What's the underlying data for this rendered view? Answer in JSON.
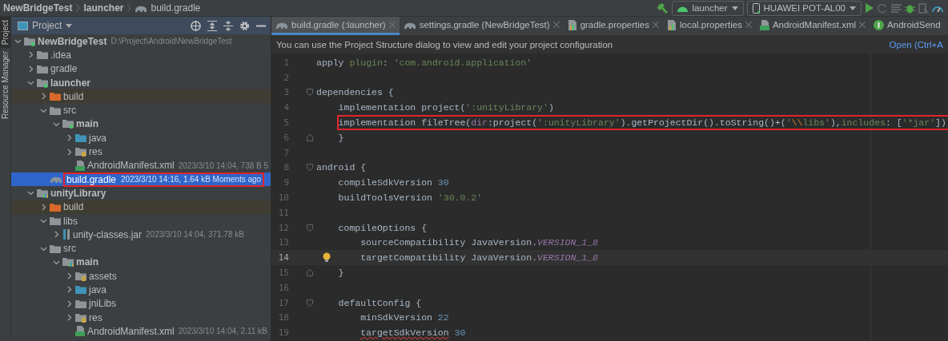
{
  "breadcrumb": [
    {
      "label": "NewBridgeTest",
      "kind": "module"
    },
    {
      "label": "launcher",
      "kind": "module"
    },
    {
      "label": "build.gradle",
      "kind": "file"
    }
  ],
  "toolbar": {
    "run_config": "launcher",
    "device": "HUAWEI POT-AL00"
  },
  "side_strip": [
    {
      "label": "Project",
      "selected": true
    },
    {
      "label": "Resource Manager",
      "selected": false
    }
  ],
  "project_panel": {
    "title": "Project",
    "tree": [
      {
        "name": "NewBridgeTest",
        "kind": "module",
        "bold": true,
        "meta": "D:\\Project\\Android\\NewBridgeTest",
        "expanded": true,
        "children": [
          {
            "name": ".idea",
            "kind": "folder",
            "expanded": false
          },
          {
            "name": "gradle",
            "kind": "folder",
            "expanded": false
          },
          {
            "name": "launcher",
            "kind": "module",
            "bold": true,
            "expanded": true,
            "children": [
              {
                "name": "build",
                "kind": "excluded",
                "excluded": true,
                "expanded": false
              },
              {
                "name": "src",
                "kind": "folder",
                "expanded": true,
                "children": [
                  {
                    "name": "main",
                    "kind": "module",
                    "bold": true,
                    "expanded": true,
                    "children": [
                      {
                        "name": "java",
                        "kind": "source",
                        "expanded": false
                      },
                      {
                        "name": "res",
                        "kind": "resource",
                        "expanded": false
                      },
                      {
                        "name": "AndroidManifest.xml",
                        "kind": "manifest",
                        "meta": "2023/3/10 14:04, 738 B 5"
                      }
                    ]
                  }
                ]
              },
              {
                "name": "build.gradle",
                "kind": "gradle",
                "meta": "2023/3/10 14:16, 1.64 kB Moments ago",
                "selected": true,
                "annotated": true
              }
            ]
          },
          {
            "name": "unityLibrary",
            "kind": "library",
            "bold": true,
            "expanded": true,
            "children": [
              {
                "name": "build",
                "kind": "excluded",
                "excluded": true,
                "expanded": false
              },
              {
                "name": "libs",
                "kind": "folder",
                "expanded": true,
                "children": [
                  {
                    "name": "unity-classes.jar",
                    "kind": "jar",
                    "meta": "2023/3/10 14:04, 371.78 kB",
                    "expanded": false
                  }
                ]
              },
              {
                "name": "src",
                "kind": "folder",
                "expanded": true,
                "children": [
                  {
                    "name": "main",
                    "kind": "library",
                    "bold": true,
                    "expanded": true,
                    "children": [
                      {
                        "name": "assets",
                        "kind": "resource",
                        "expanded": false
                      },
                      {
                        "name": "java",
                        "kind": "source",
                        "expanded": false
                      },
                      {
                        "name": "jniLibs",
                        "kind": "folder",
                        "expanded": false
                      },
                      {
                        "name": "res",
                        "kind": "resource",
                        "expanded": false
                      },
                      {
                        "name": "AndroidManifest.xml",
                        "kind": "manifest",
                        "meta": "2023/3/10 14:04, 2.11 kB"
                      }
                    ]
                  }
                ]
              }
            ]
          }
        ]
      }
    ]
  },
  "tabs": [
    {
      "label": "build.gradle (:launcher)",
      "kind": "gradle",
      "selected": true,
      "closable": true
    },
    {
      "label": "settings.gradle (NewBridgeTest)",
      "kind": "gradle",
      "selected": false,
      "closable": true
    },
    {
      "label": "gradle.properties",
      "kind": "properties",
      "selected": false,
      "closable": true
    },
    {
      "label": "local.properties",
      "kind": "properties",
      "selected": false,
      "closable": true
    },
    {
      "label": "AndroidManifest.xml",
      "kind": "manifest",
      "selected": false,
      "closable": true
    },
    {
      "label": "AndroidSend",
      "kind": "class",
      "selected": false,
      "closable": false
    }
  ],
  "notification": {
    "text": "You can use the Project Structure dialog to view and edit your project configuration",
    "link": "Open (Ctrl+A"
  },
  "code": [
    {
      "number": "1",
      "tokens": [
        {
          "kind": "plain",
          "text": "apply "
        },
        {
          "kind": "named",
          "text": "plugin"
        },
        {
          "kind": "plain",
          "text": ": "
        },
        {
          "kind": "string",
          "text": "'com.android.application'"
        }
      ]
    },
    {
      "number": "2"
    },
    {
      "number": "3",
      "fold_open": true,
      "tokens": [
        {
          "kind": "plain",
          "text": "dependencies {"
        }
      ]
    },
    {
      "number": "4",
      "tokens": [
        {
          "kind": "plain",
          "text": "    implementation project("
        },
        {
          "kind": "string",
          "text": "':unityLibrary'"
        },
        {
          "kind": "plain",
          "text": ")"
        }
      ]
    },
    {
      "number": "5",
      "annotated": true,
      "tokens": [
        {
          "kind": "plain",
          "text": "    implementation fileTree("
        },
        {
          "kind": "param",
          "text": "dir"
        },
        {
          "kind": "plain",
          "text": ":project("
        },
        {
          "kind": "string",
          "text": "':unityLibrary'"
        },
        {
          "kind": "plain",
          "text": ").getProjectDir().toString()+("
        },
        {
          "kind": "string",
          "text": "'"
        },
        {
          "kind": "escape",
          "text": "\\\\"
        },
        {
          "kind": "string",
          "text": "libs'"
        },
        {
          "kind": "plain",
          "text": "),"
        },
        {
          "kind": "named",
          "text": "includes"
        },
        {
          "kind": "plain",
          "text": ": ["
        },
        {
          "kind": "string",
          "text": "'*jar'"
        },
        {
          "kind": "plain",
          "text": "])"
        }
      ]
    },
    {
      "number": "6",
      "fold_close": true,
      "tokens": [
        {
          "kind": "plain",
          "text": "    }"
        }
      ]
    },
    {
      "number": "7"
    },
    {
      "number": "8",
      "fold_open": true,
      "tokens": [
        {
          "kind": "plain",
          "text": "android {"
        }
      ]
    },
    {
      "number": "9",
      "tokens": [
        {
          "kind": "plain",
          "text": "    compileSdkVersion "
        },
        {
          "kind": "number",
          "text": "30"
        }
      ]
    },
    {
      "number": "10",
      "tokens": [
        {
          "kind": "plain",
          "text": "    buildToolsVersion "
        },
        {
          "kind": "string",
          "text": "'30.0.2'"
        }
      ]
    },
    {
      "number": "11"
    },
    {
      "number": "12",
      "fold_open": true,
      "tokens": [
        {
          "kind": "plain",
          "text": "    compileOptions {"
        }
      ]
    },
    {
      "number": "13",
      "tokens": [
        {
          "kind": "plain",
          "text": "        sourceCompatibility JavaVersion."
        },
        {
          "kind": "static",
          "text": "VERSION_1_8"
        }
      ]
    },
    {
      "number": "14",
      "current": true,
      "intention": true,
      "tokens": [
        {
          "kind": "plain",
          "text": "        targetCompatibility JavaVersion."
        },
        {
          "kind": "static",
          "text": "VERSION_1_8"
        }
      ]
    },
    {
      "number": "15",
      "fold_close": true,
      "tokens": [
        {
          "kind": "plain",
          "text": "    }"
        }
      ]
    },
    {
      "number": "16"
    },
    {
      "number": "17",
      "fold_open": true,
      "tokens": [
        {
          "kind": "plain",
          "text": "    defaultConfig {"
        }
      ]
    },
    {
      "number": "18",
      "tokens": [
        {
          "kind": "plain",
          "text": "        minSdkVersion "
        },
        {
          "kind": "number",
          "text": "22"
        }
      ]
    },
    {
      "number": "19",
      "tokens": [
        {
          "kind": "error",
          "text": "        targetSdkVersion"
        },
        {
          "kind": "number",
          "text": " 30"
        }
      ]
    }
  ]
}
